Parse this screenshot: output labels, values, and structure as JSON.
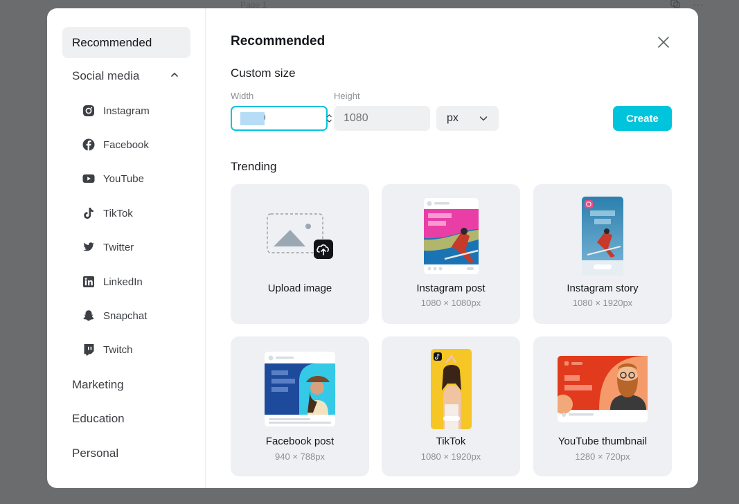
{
  "background": {
    "page_label": "Page 1"
  },
  "sidebar": {
    "items": [
      {
        "label": "Recommended",
        "active": true
      },
      {
        "label": "Social media",
        "expanded": true
      },
      {
        "label": "Marketing"
      },
      {
        "label": "Education"
      },
      {
        "label": "Personal"
      }
    ],
    "social_items": [
      {
        "label": "Instagram",
        "icon": "instagram-icon"
      },
      {
        "label": "Facebook",
        "icon": "facebook-icon"
      },
      {
        "label": "YouTube",
        "icon": "youtube-icon"
      },
      {
        "label": "TikTok",
        "icon": "tiktok-icon"
      },
      {
        "label": "Twitter",
        "icon": "twitter-icon"
      },
      {
        "label": "LinkedIn",
        "icon": "linkedin-icon"
      },
      {
        "label": "Snapchat",
        "icon": "snapchat-icon"
      },
      {
        "label": "Twitch",
        "icon": "twitch-icon"
      }
    ]
  },
  "main": {
    "title": "Recommended",
    "custom_size": {
      "heading": "Custom size",
      "width_label": "Width",
      "width_value": "1080",
      "height_label": "Height",
      "height_placeholder": "1080",
      "unit": "px",
      "create_label": "Create"
    },
    "trending": {
      "heading": "Trending",
      "cards": [
        {
          "name": "Upload image",
          "dims": ""
        },
        {
          "name": "Instagram post",
          "dims": "1080 × 1080px"
        },
        {
          "name": "Instagram story",
          "dims": "1080 × 1920px"
        },
        {
          "name": "Facebook post",
          "dims": "940 × 788px"
        },
        {
          "name": "TikTok",
          "dims": "1080 × 1920px"
        },
        {
          "name": "YouTube thumbnail",
          "dims": "1280 × 720px"
        }
      ]
    }
  },
  "colors": {
    "accent": "#00c4dc",
    "backdrop": "#6b6c6e",
    "card_bg": "#eef0f3"
  }
}
